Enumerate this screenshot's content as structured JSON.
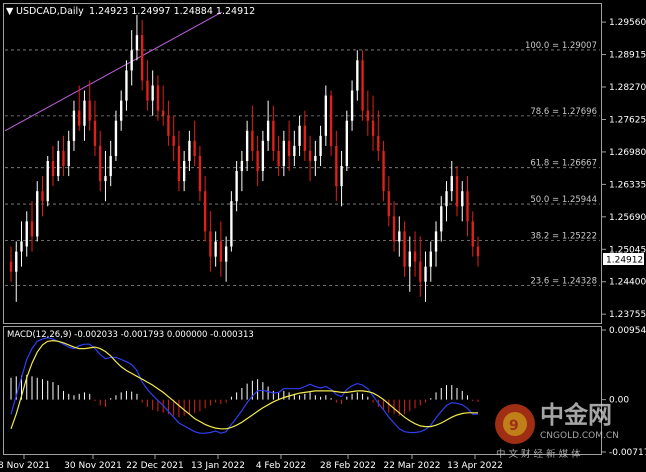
{
  "header": {
    "symbol_timeframe": "USDCAD,Daily",
    "ohlc": "1.24923 1.24997 1.24884 1.24912",
    "collapse_arrow": "▼"
  },
  "macd_header": "MACD(12,26,9) -0.002033 -0.001793 0.000000 -0.000313",
  "current_price": "1.24912",
  "watermark": {
    "brand": "中金网",
    "domain": "CNGOLD.COM.CN",
    "slogan": "中 文 财 经 新 媒 体"
  },
  "colors": {
    "background": "#000000",
    "bull": "#ffffff",
    "bear": "#e0201a",
    "grid": "#8a8a8a",
    "macd_signal": "#f2e94e",
    "macd_line": "#2e3ff0",
    "trendline": "#c060e0"
  },
  "chart_data": [
    {
      "type": "candlestick",
      "symbol": "USDCAD",
      "timeframe": "Daily",
      "ylim": [
        1.236,
        1.299
      ],
      "y_ticks": [
        "1.29560",
        "1.28915",
        "1.28270",
        "1.27625",
        "1.26980",
        "1.26335",
        "1.25690",
        "1.25045",
        "1.24400",
        "1.23755"
      ],
      "x_ticks": [
        "8 Nov 2021",
        "30 Nov 2021",
        "22 Dec 2021",
        "13 Jan 2022",
        "4 Feb 2022",
        "28 Feb 2022",
        "22 Mar 2022",
        "13 Apr 2022"
      ],
      "fibonacci": [
        {
          "label": "100.0 = 1.29007",
          "value": 1.29007
        },
        {
          "label": "78.6 = 1.27696",
          "value": 1.27696
        },
        {
          "label": "61.8 = 1.26667",
          "value": 1.26667
        },
        {
          "label": "50.0 = 1.25944",
          "value": 1.25944
        },
        {
          "label": "38.2 = 1.25222",
          "value": 1.25222
        },
        {
          "label": "23.6 = 1.24328",
          "value": 1.24328
        }
      ],
      "trendline": {
        "from": [
          0,
          1.274
        ],
        "to": [
          36,
          1.296
        ]
      },
      "candles": [
        [
          1.248,
          1.251,
          1.244,
          1.246
        ],
        [
          1.246,
          1.252,
          1.24,
          1.25
        ],
        [
          1.25,
          1.256,
          1.247,
          1.252
        ],
        [
          1.251,
          1.258,
          1.249,
          1.256
        ],
        [
          1.256,
          1.26,
          1.25,
          1.253
        ],
        [
          1.253,
          1.264,
          1.252,
          1.262
        ],
        [
          1.262,
          1.265,
          1.257,
          1.26
        ],
        [
          1.26,
          1.269,
          1.259,
          1.268
        ],
        [
          1.268,
          1.271,
          1.263,
          1.265
        ],
        [
          1.265,
          1.272,
          1.264,
          1.27
        ],
        [
          1.27,
          1.273,
          1.265,
          1.267
        ],
        [
          1.267,
          1.274,
          1.265,
          1.272
        ],
        [
          1.272,
          1.28,
          1.27,
          1.278
        ],
        [
          1.278,
          1.283,
          1.274,
          1.275
        ],
        [
          1.275,
          1.282,
          1.272,
          1.28
        ],
        [
          1.28,
          1.284,
          1.274,
          1.276
        ],
        [
          1.276,
          1.28,
          1.269,
          1.271
        ],
        [
          1.271,
          1.274,
          1.262,
          1.264
        ],
        [
          1.264,
          1.27,
          1.26,
          1.265
        ],
        [
          1.265,
          1.272,
          1.263,
          1.269
        ],
        [
          1.269,
          1.278,
          1.268,
          1.276
        ],
        [
          1.276,
          1.282,
          1.274,
          1.28
        ],
        [
          1.28,
          1.288,
          1.278,
          1.286
        ],
        [
          1.286,
          1.294,
          1.283,
          1.29
        ],
        [
          1.29,
          1.297,
          1.288,
          1.293
        ],
        [
          1.293,
          1.296,
          1.282,
          1.284
        ],
        [
          1.284,
          1.288,
          1.278,
          1.28
        ],
        [
          1.28,
          1.286,
          1.277,
          1.283
        ],
        [
          1.283,
          1.285,
          1.276,
          1.278
        ],
        [
          1.278,
          1.283,
          1.275,
          1.277
        ],
        [
          1.277,
          1.28,
          1.271,
          1.273
        ],
        [
          1.273,
          1.277,
          1.268,
          1.271
        ],
        [
          1.271,
          1.274,
          1.262,
          1.264
        ],
        [
          1.264,
          1.27,
          1.262,
          1.268
        ],
        [
          1.268,
          1.274,
          1.266,
          1.272
        ],
        [
          1.272,
          1.276,
          1.267,
          1.269
        ],
        [
          1.269,
          1.271,
          1.26,
          1.262
        ],
        [
          1.262,
          1.265,
          1.252,
          1.254
        ],
        [
          1.254,
          1.258,
          1.246,
          1.249
        ],
        [
          1.249,
          1.254,
          1.247,
          1.252
        ],
        [
          1.252,
          1.256,
          1.245,
          1.248
        ],
        [
          1.248,
          1.253,
          1.244,
          1.251
        ],
        [
          1.251,
          1.262,
          1.25,
          1.26
        ],
        [
          1.26,
          1.268,
          1.258,
          1.266
        ],
        [
          1.266,
          1.27,
          1.262,
          1.268
        ],
        [
          1.268,
          1.276,
          1.266,
          1.274
        ],
        [
          1.274,
          1.279,
          1.268,
          1.27
        ],
        [
          1.27,
          1.273,
          1.263,
          1.266
        ],
        [
          1.266,
          1.274,
          1.264,
          1.272
        ],
        [
          1.272,
          1.28,
          1.27,
          1.276
        ],
        [
          1.276,
          1.279,
          1.268,
          1.27
        ],
        [
          1.27,
          1.273,
          1.265,
          1.267
        ],
        [
          1.267,
          1.274,
          1.265,
          1.272
        ],
        [
          1.272,
          1.276,
          1.266,
          1.269
        ],
        [
          1.269,
          1.274,
          1.267,
          1.271
        ],
        [
          1.271,
          1.277,
          1.269,
          1.275
        ],
        [
          1.275,
          1.278,
          1.268,
          1.27
        ],
        [
          1.27,
          1.273,
          1.264,
          1.268
        ],
        [
          1.268,
          1.272,
          1.265,
          1.269
        ],
        [
          1.269,
          1.275,
          1.267,
          1.273
        ],
        [
          1.273,
          1.283,
          1.271,
          1.281
        ],
        [
          1.281,
          1.282,
          1.269,
          1.271
        ],
        [
          1.271,
          1.274,
          1.26,
          1.263
        ],
        [
          1.263,
          1.27,
          1.259,
          1.267
        ],
        [
          1.267,
          1.278,
          1.266,
          1.276
        ],
        [
          1.276,
          1.284,
          1.274,
          1.282
        ],
        [
          1.282,
          1.29,
          1.28,
          1.288
        ],
        [
          1.288,
          1.29,
          1.276,
          1.278
        ],
        [
          1.278,
          1.282,
          1.273,
          1.276
        ],
        [
          1.276,
          1.281,
          1.27,
          1.273
        ],
        [
          1.273,
          1.278,
          1.268,
          1.27
        ],
        [
          1.27,
          1.272,
          1.26,
          1.262
        ],
        [
          1.262,
          1.265,
          1.255,
          1.257
        ],
        [
          1.257,
          1.26,
          1.25,
          1.252
        ],
        [
          1.252,
          1.257,
          1.249,
          1.254
        ],
        [
          1.254,
          1.256,
          1.245,
          1.247
        ],
        [
          1.247,
          1.253,
          1.242,
          1.25
        ],
        [
          1.25,
          1.254,
          1.245,
          1.248
        ],
        [
          1.248,
          1.253,
          1.241,
          1.244
        ],
        [
          1.244,
          1.25,
          1.24,
          1.247
        ],
        [
          1.247,
          1.252,
          1.244,
          1.25
        ],
        [
          1.25,
          1.256,
          1.247,
          1.254
        ],
        [
          1.254,
          1.261,
          1.252,
          1.259
        ],
        [
          1.259,
          1.264,
          1.256,
          1.262
        ],
        [
          1.262,
          1.268,
          1.26,
          1.265
        ],
        [
          1.265,
          1.267,
          1.257,
          1.259
        ],
        [
          1.259,
          1.264,
          1.256,
          1.262
        ],
        [
          1.262,
          1.265,
          1.253,
          1.256
        ],
        [
          1.256,
          1.258,
          1.249,
          1.251
        ],
        [
          1.251,
          1.253,
          1.247,
          1.2491
        ]
      ]
    },
    {
      "type": "macd",
      "params": "12,26,9",
      "ylim": [
        -0.007178,
        0.009549
      ],
      "y_ticks": [
        "0.009549",
        "0.00",
        "-0.007178"
      ],
      "histogram": [
        0.003,
        0.0032,
        0.0033,
        0.0034,
        0.0032,
        0.003,
        0.0028,
        0.0026,
        0.0024,
        0.002,
        0.0012,
        0.0008,
        0.0006,
        0.0008,
        0.001,
        0.0008,
        -0.0002,
        -0.0008,
        -0.001,
        0.0002,
        0.0006,
        0.001,
        0.0012,
        0.0011,
        0.0008,
        -0.0004,
        -0.001,
        -0.0014,
        -0.0016,
        -0.0018,
        -0.002,
        -0.0022,
        -0.0024,
        -0.0022,
        -0.002,
        -0.0018,
        -0.0016,
        -0.0012,
        -0.0008,
        -0.0004,
        -0.0006,
        -0.0004,
        0.0004,
        0.001,
        0.0016,
        0.0022,
        0.0026,
        0.0028,
        0.0024,
        0.0018,
        0.0012,
        0.001,
        0.0012,
        0.001,
        0.0008,
        0.0006,
        0.0008,
        0.001,
        0.0006,
        0.0004,
        0.0006,
        0.0002,
        -0.0004,
        -0.0006,
        0.0004,
        0.0008,
        0.001,
        0.0008,
        0.0004,
        -0.0004,
        -0.001,
        -0.0014,
        -0.0018,
        -0.002,
        -0.0022,
        -0.002,
        -0.0016,
        -0.0012,
        -0.0008,
        -0.0004,
        0.0002,
        0.001,
        0.0016,
        0.002,
        0.002,
        0.0016,
        0.0012,
        0.0006,
        -0.0002,
        -0.0003
      ],
      "signal": [
        -0.004,
        -0.002,
        0.0005,
        0.003,
        0.005,
        0.0065,
        0.0075,
        0.008,
        0.0081,
        0.008,
        0.0078,
        0.0075,
        0.0072,
        0.007,
        0.007,
        0.0071,
        0.0072,
        0.007,
        0.0066,
        0.006,
        0.0052,
        0.0045,
        0.004,
        0.0036,
        0.0032,
        0.0028,
        0.0024,
        0.002,
        0.0015,
        0.001,
        0.0004,
        -0.0002,
        -0.0008,
        -0.0014,
        -0.002,
        -0.0026,
        -0.003,
        -0.0034,
        -0.0037,
        -0.0039,
        -0.004,
        -0.004,
        -0.0038,
        -0.0035,
        -0.0031,
        -0.0026,
        -0.0021,
        -0.0016,
        -0.0011,
        -0.0007,
        -0.0003,
        0.0,
        0.0003,
        0.0005,
        0.0007,
        0.0009,
        0.001,
        0.0011,
        0.0012,
        0.0012,
        0.0012,
        0.0012,
        0.0011,
        0.001,
        0.001,
        0.0011,
        0.0012,
        0.0012,
        0.0011,
        0.0009,
        0.0005,
        0.0,
        -0.0006,
        -0.0012,
        -0.0018,
        -0.0024,
        -0.0029,
        -0.0033,
        -0.0036,
        -0.0037,
        -0.0037,
        -0.0035,
        -0.0032,
        -0.0028,
        -0.0024,
        -0.0021,
        -0.0019,
        -0.0018,
        -0.0018,
        -0.0018
      ],
      "macd": [
        -0.002,
        0.0005,
        0.003,
        0.0055,
        0.007,
        0.008,
        0.0083,
        0.0085,
        0.0083,
        0.008,
        0.0076,
        0.0072,
        0.007,
        0.0074,
        0.0076,
        0.0076,
        0.007,
        0.0062,
        0.0056,
        0.0058,
        0.0058,
        0.0055,
        0.0052,
        0.0048,
        0.004,
        0.0024,
        0.0014,
        0.0006,
        -0.0001,
        -0.0008,
        -0.0016,
        -0.0024,
        -0.0032,
        -0.0036,
        -0.004,
        -0.0044,
        -0.0046,
        -0.0046,
        -0.0045,
        -0.0043,
        -0.0046,
        -0.0044,
        -0.0034,
        -0.0025,
        -0.0015,
        -0.0004,
        0.0005,
        0.0012,
        0.0013,
        0.0011,
        0.0009,
        0.001,
        0.0015,
        0.0015,
        0.0015,
        0.0015,
        0.0018,
        0.0021,
        0.0018,
        0.0016,
        0.0018,
        0.0014,
        0.0007,
        0.0004,
        0.0014,
        0.0019,
        0.0022,
        0.002,
        0.0015,
        0.0005,
        -0.0005,
        -0.0014,
        -0.0024,
        -0.0032,
        -0.004,
        -0.0044,
        -0.0045,
        -0.0045,
        -0.0044,
        -0.0041,
        -0.0035,
        -0.0025,
        -0.0016,
        -0.0008,
        -0.0004,
        -0.0005,
        -0.0007,
        -0.0012,
        -0.002,
        -0.002
      ]
    }
  ]
}
